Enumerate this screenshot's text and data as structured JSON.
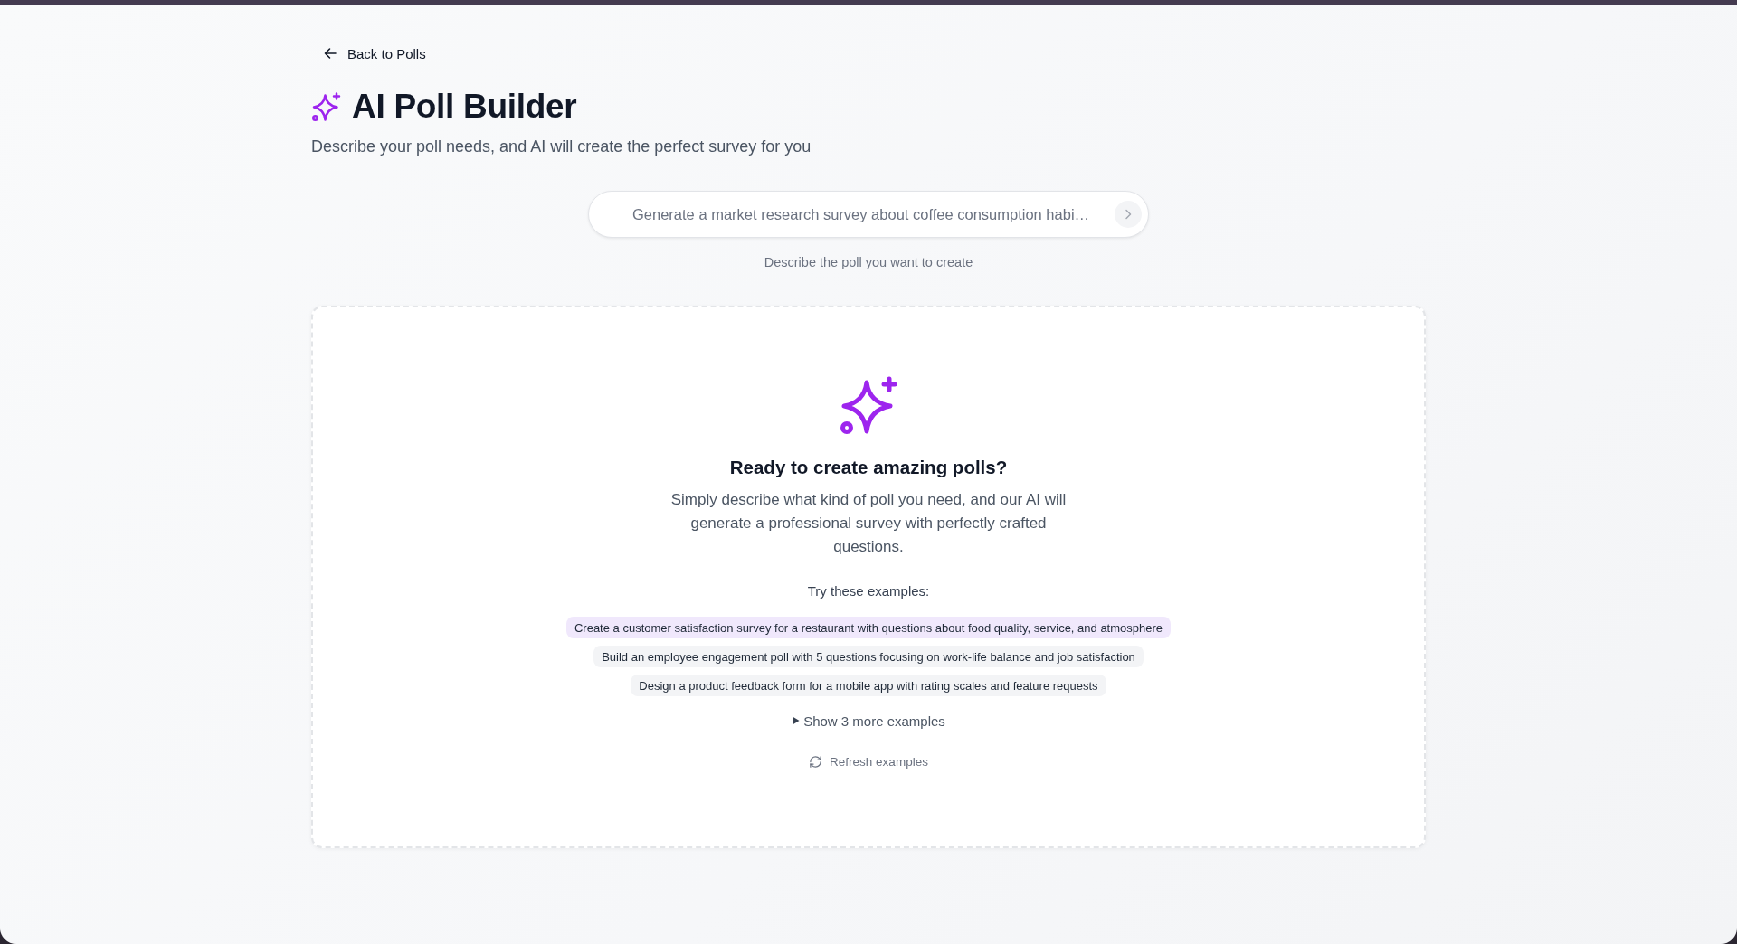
{
  "back_link": {
    "label": "Back to Polls"
  },
  "header": {
    "title": "AI Poll Builder",
    "subtitle": "Describe your poll needs, and AI will create the perfect survey for you"
  },
  "prompt": {
    "placeholder": "Generate a market research survey about coffee consumption habi…",
    "hint": "Describe the poll you want to create"
  },
  "empty_state": {
    "title": "Ready to create amazing polls?",
    "description": "Simply describe what kind of poll you need, and our AI will generate a professional survey with perfectly crafted questions.",
    "examples_label": "Try these examples:",
    "examples": [
      {
        "text": "Create a customer satisfaction survey for a restaurant with questions about food quality, service, and atmosphere",
        "selected": true
      },
      {
        "text": "Build an employee engagement poll with 5 questions focusing on work-life balance and job satisfaction",
        "selected": false
      },
      {
        "text": "Design a product feedback form for a mobile app with rating scales and feature requests",
        "selected": false
      }
    ],
    "more_toggle": {
      "label": "Show 3 more examples",
      "expanded": false
    },
    "refresh": {
      "label": "Refresh examples"
    }
  }
}
